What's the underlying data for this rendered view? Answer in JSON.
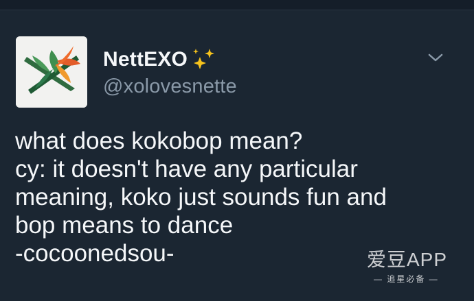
{
  "tweet": {
    "display_name": "NettEXO",
    "name_emoji": "sparkles-icon",
    "handle": "@xolovesnette",
    "lines": [
      "what does kokobop mean?",
      "cy: it doesn't have any particular",
      "meaning, koko just sounds fun and",
      "bop means to dance",
      "-cocoonedsou-"
    ]
  },
  "watermark": {
    "title": "爱豆APP",
    "subtitle": "— 追星必备 —"
  },
  "colors": {
    "background": "#1b2632",
    "text": "#f5f7f9",
    "handle": "#8a99a8",
    "sparkle": "#f6c21c"
  }
}
